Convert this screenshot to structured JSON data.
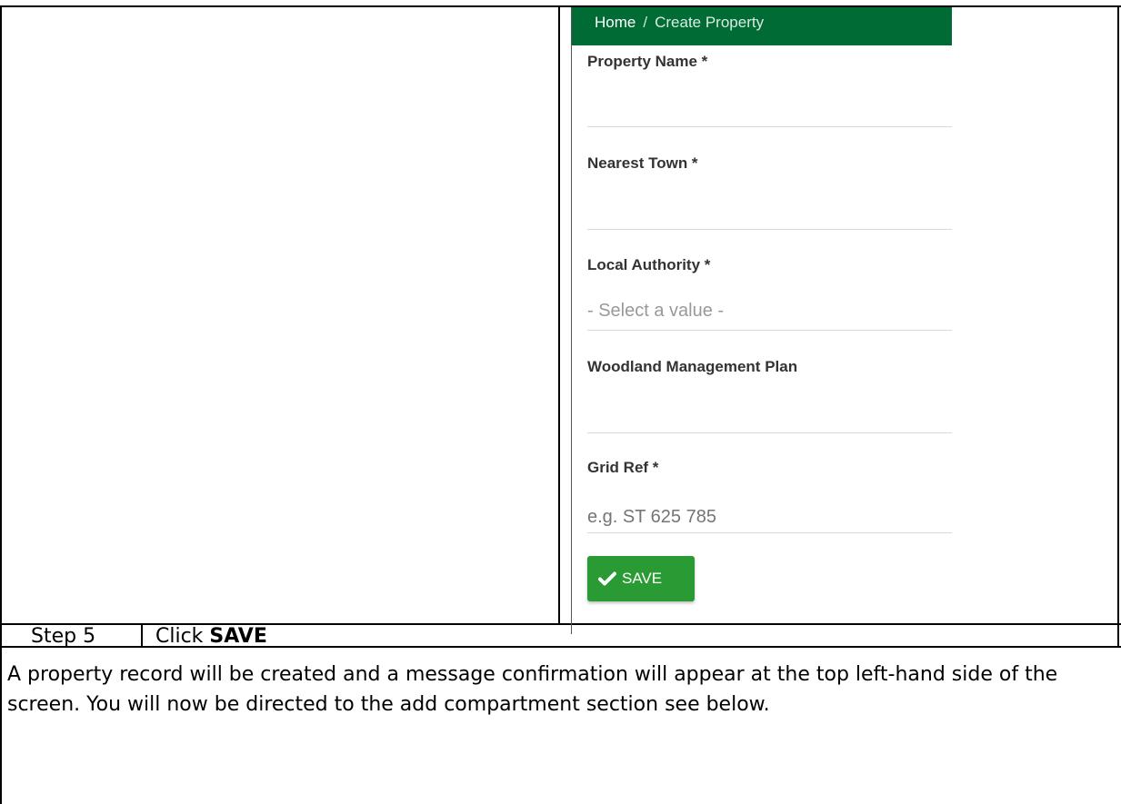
{
  "form": {
    "breadcrumb": {
      "home": "Home",
      "separator": "/",
      "current": "Create Property"
    },
    "fields": {
      "property_name": {
        "label": "Property Name *",
        "placeholder": ""
      },
      "nearest_town": {
        "label": "Nearest Town *",
        "placeholder": ""
      },
      "local_authority": {
        "label": "Local Authority *",
        "value": "- Select a value -"
      },
      "woodland_plan": {
        "label": "Woodland Management Plan",
        "placeholder": ""
      },
      "grid_ref": {
        "label": "Grid Ref *",
        "placeholder": "e.g. ST 625 785"
      }
    },
    "save_label": "SAVE"
  },
  "step": {
    "number": "Step 5",
    "instruction_prefix": "Click ",
    "instruction_bold": "SAVE"
  },
  "description": "A property record will be created and a message confirmation will appear at the top left-hand side of the screen. You will now be directed to the add compartment section see below."
}
